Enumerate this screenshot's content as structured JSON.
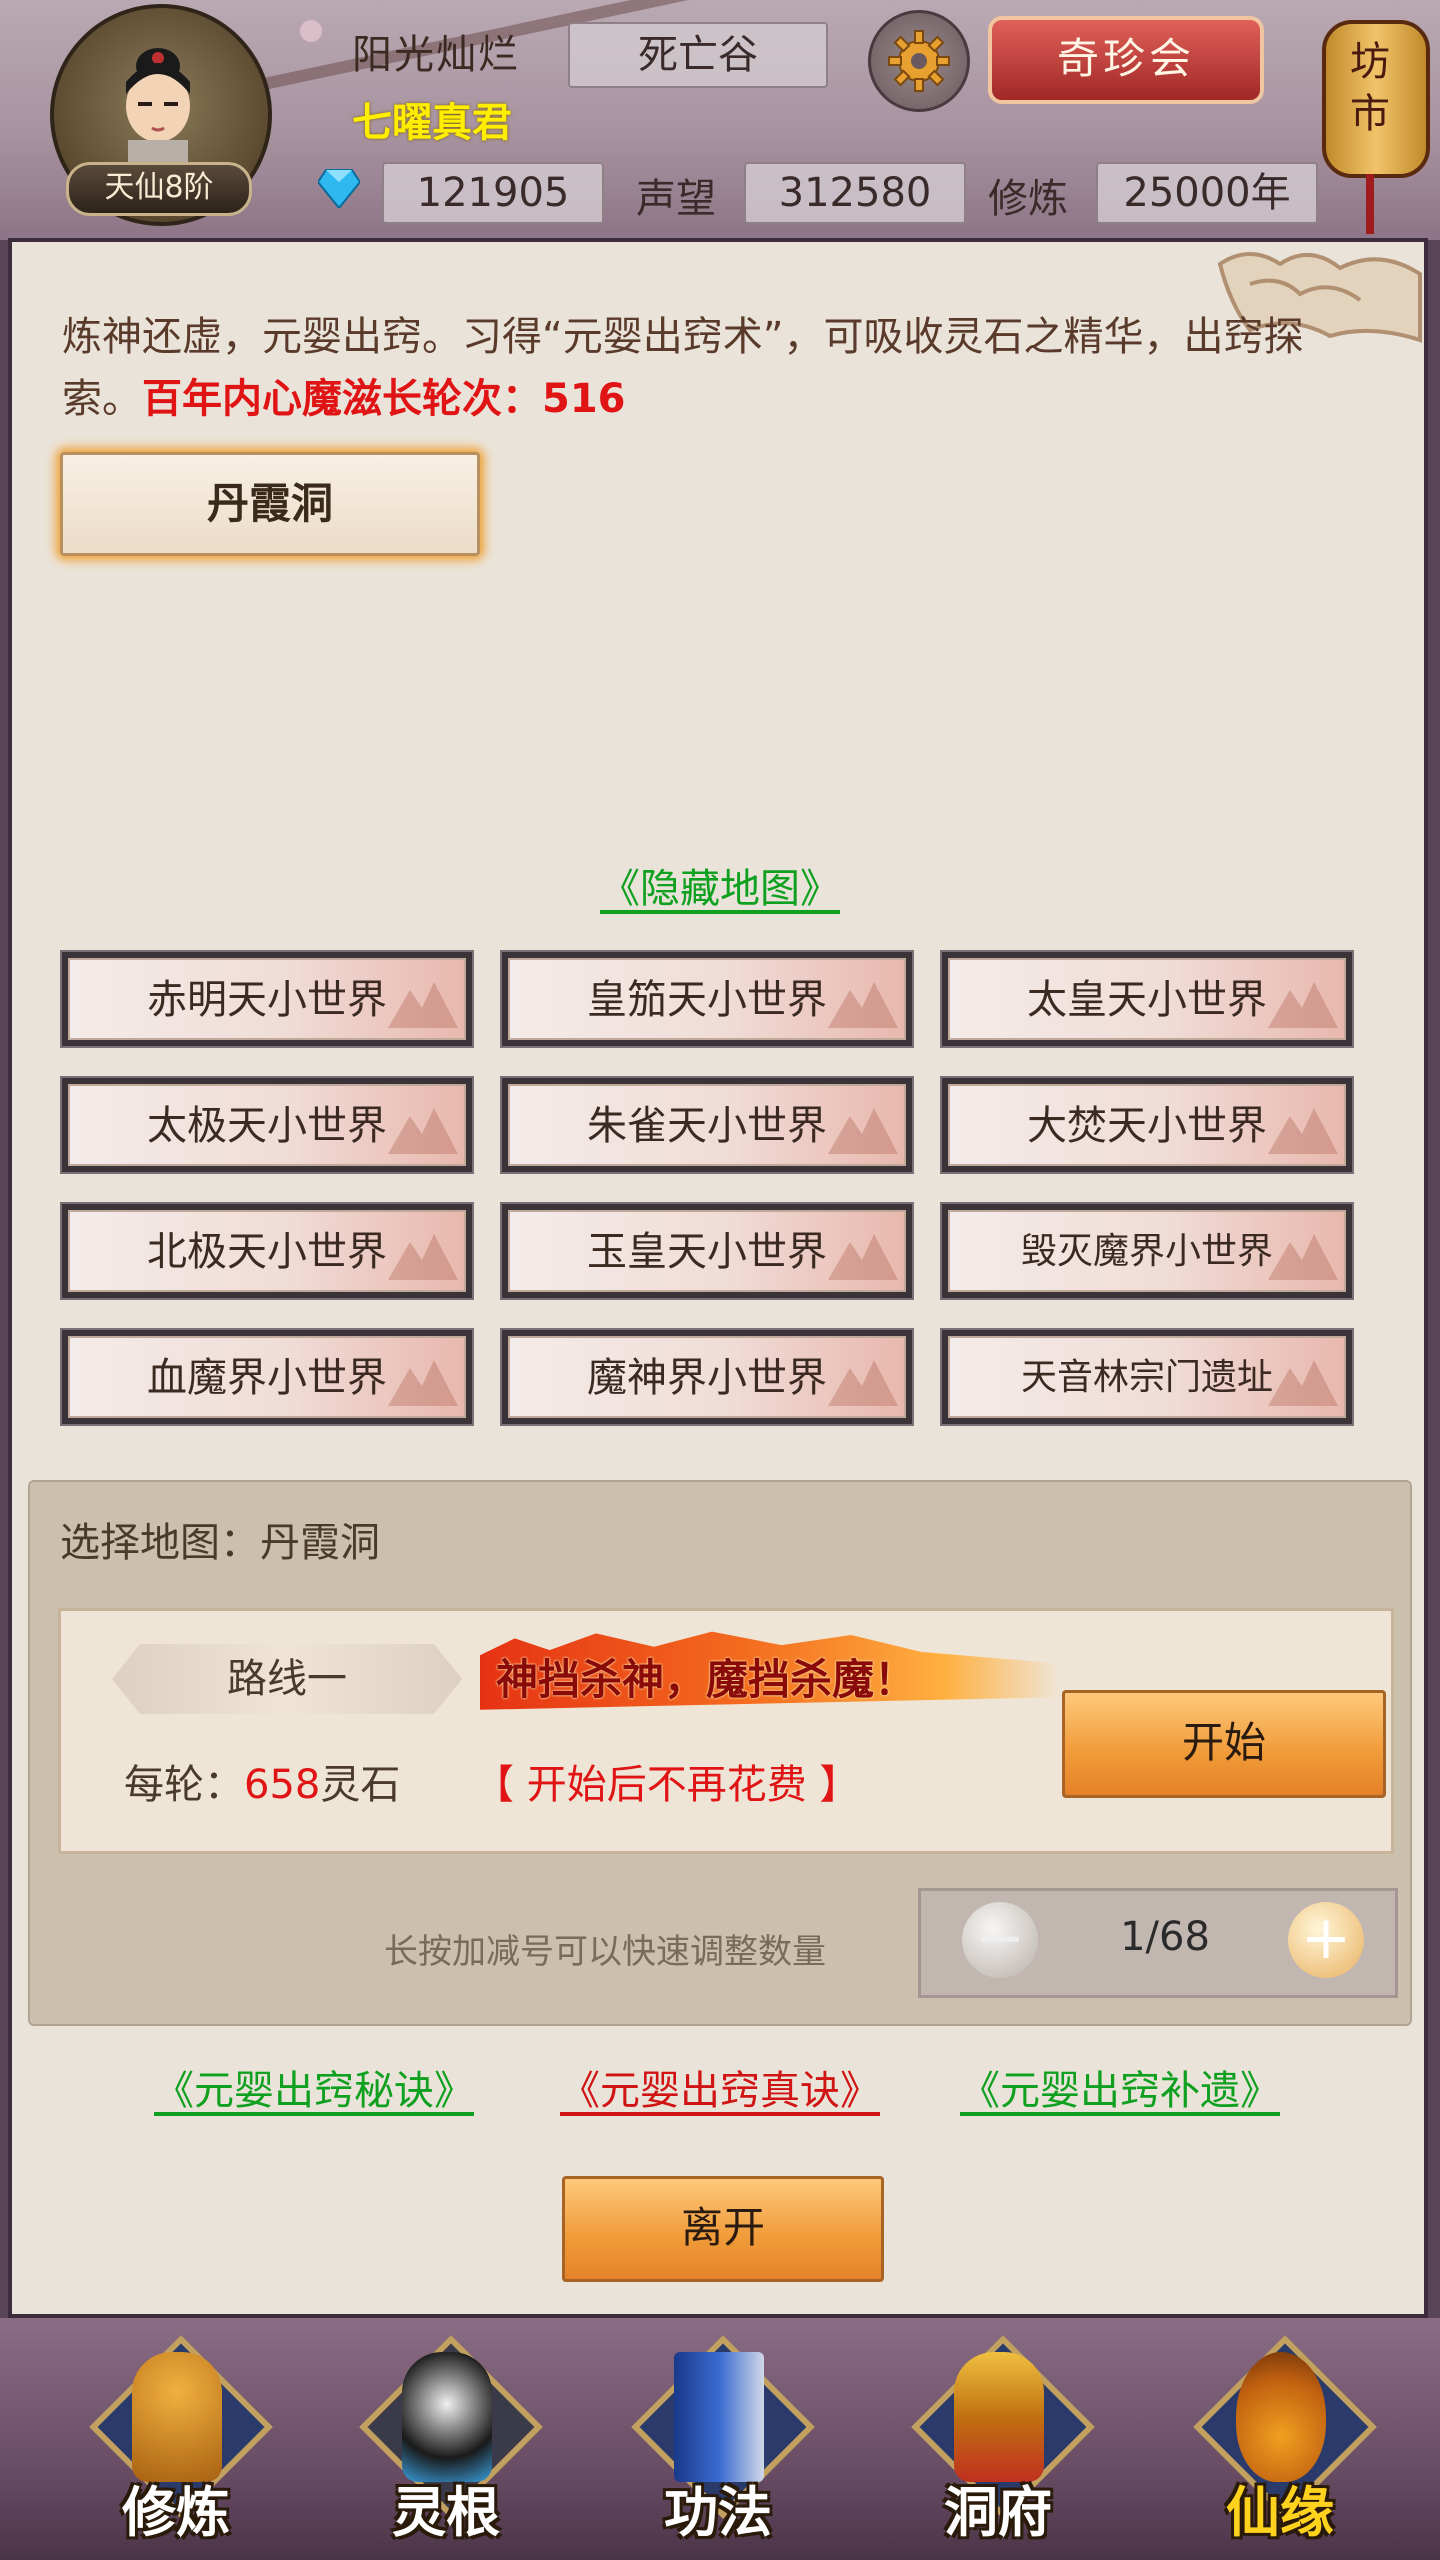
{
  "header": {
    "player_name": "阳光灿烂",
    "player_title": "七曜真君",
    "rank": "天仙8阶",
    "location": "死亡谷",
    "shop_label": "奇珍会",
    "market_label": "坊市",
    "spirit_stones": "121905",
    "prestige_label": "声望",
    "prestige": "312580",
    "cultivation_label": "修炼",
    "cultivation": "25000年"
  },
  "main": {
    "intro_text": "炼神还虚，元婴出窍。习得“元婴出窍术”，可吸收灵石之精华，出窍探索。",
    "intro_highlight": "百年内心魔滋长轮次：516",
    "selected_map_button": "丹霞洞",
    "hidden_map_link": "《隐藏地图》",
    "maps": [
      "赤明天小世界",
      "皇笳天小世界",
      "太皇天小世界",
      "太极天小世界",
      "朱雀天小世界",
      "大焚天小世界",
      "北极天小世界",
      "玉皇天小世界",
      "毁灭魔界小世界",
      "血魔界小世界",
      "魔神界小世界",
      "天音林宗门遗址"
    ]
  },
  "select": {
    "title": "选择地图：丹霞洞",
    "route_label": "路线一",
    "slogan": "神挡杀神，魔挡杀魔！",
    "cost_prefix": "每轮：",
    "cost_value": "658",
    "cost_unit": "灵石",
    "no_cost_note": "【 开始后不再花费 】",
    "start_button": "开始",
    "hint": "长按加减号可以快速调整数量",
    "minus_symbol": "−",
    "plus_symbol": "+",
    "quantity": "1/68"
  },
  "books": [
    {
      "label": "《元婴出窍秘诀》",
      "color": "#10a020"
    },
    {
      "label": "《元婴出窍真诀》",
      "color": "#d01414"
    },
    {
      "label": "《元婴出窍补遗》",
      "color": "#10a020"
    }
  ],
  "leave_button": "离开",
  "nav": [
    {
      "label": "修炼",
      "icon": "monk-icon",
      "active": false
    },
    {
      "label": "灵根",
      "icon": "sword-icon",
      "active": false
    },
    {
      "label": "功法",
      "icon": "book-icon",
      "active": false
    },
    {
      "label": "洞府",
      "icon": "pagoda-icon",
      "active": false
    },
    {
      "label": "仙缘",
      "icon": "gourd-icon",
      "active": true
    }
  ]
}
